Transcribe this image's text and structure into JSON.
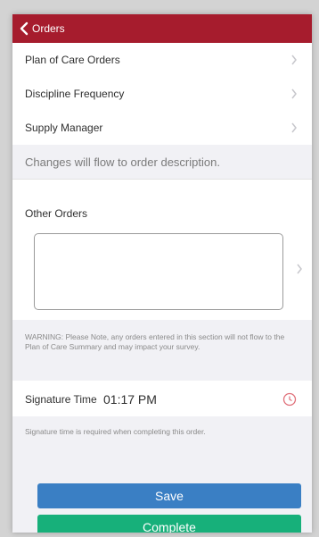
{
  "colors": {
    "header": "#a61c2d",
    "save_button": "#3a7fc4",
    "complete_button": "#17b07a",
    "clock_icon": "#e0707a"
  },
  "header": {
    "back_label": "Orders",
    "back_icon": "chevron-left-icon"
  },
  "menu": {
    "items": [
      {
        "label": "Plan of Care Orders"
      },
      {
        "label": "Discipline Frequency"
      },
      {
        "label": "Supply Manager"
      }
    ],
    "note": "Changes will flow to order description."
  },
  "other_orders": {
    "label": "Other Orders",
    "value": "",
    "warning": "WARNING: Please Note, any orders entered in this section will not flow to the Plan of Care Summary and may impact your survey."
  },
  "signature": {
    "label": "Signature Time",
    "value": "01:17 PM",
    "icon": "clock-icon",
    "note": "Signature time is required when completing this order."
  },
  "buttons": {
    "save": "Save",
    "complete": "Complete"
  }
}
